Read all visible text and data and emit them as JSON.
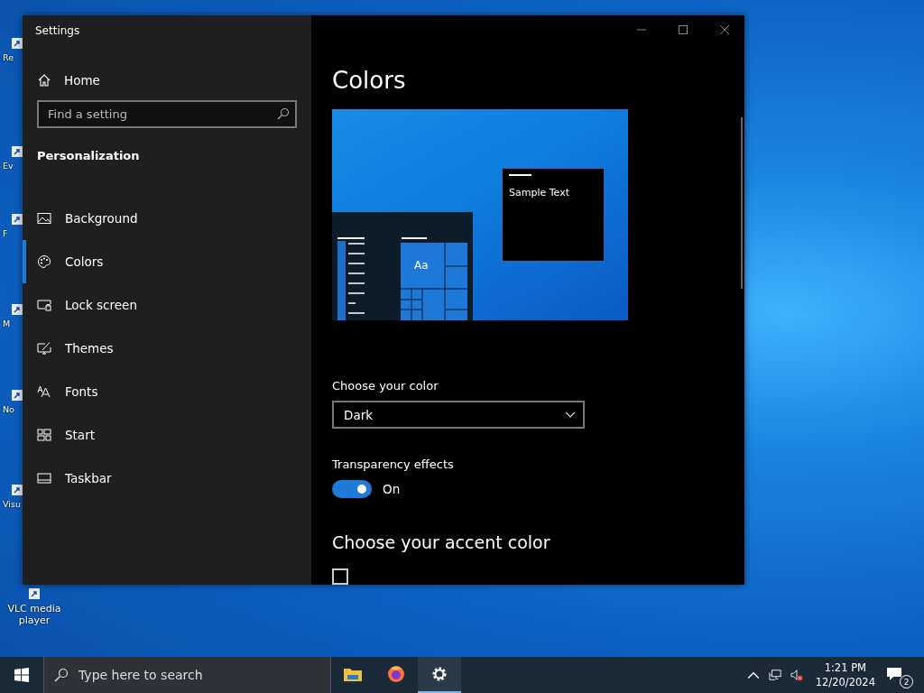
{
  "desktop": {
    "icons": [
      {
        "label": "Re"
      },
      {
        "label": "Ev"
      },
      {
        "label": "F"
      },
      {
        "label": "M"
      },
      {
        "label": "No"
      },
      {
        "label": "Visu"
      },
      {
        "label": "VLC media player"
      }
    ]
  },
  "window": {
    "title": "Settings"
  },
  "sidebar": {
    "home": "Home",
    "search": {
      "placeholder": "Find a setting"
    },
    "section": "Personalization",
    "items": [
      {
        "label": "Background",
        "selected": false
      },
      {
        "label": "Colors",
        "selected": true
      },
      {
        "label": "Lock screen",
        "selected": false
      },
      {
        "label": "Themes",
        "selected": false
      },
      {
        "label": "Fonts",
        "selected": false
      },
      {
        "label": "Start",
        "selected": false
      },
      {
        "label": "Taskbar",
        "selected": false
      }
    ]
  },
  "content": {
    "title": "Colors",
    "preview": {
      "sample_text": "Sample Text",
      "tile_text": "Aa"
    },
    "color_label": "Choose your color",
    "color_value": "Dark",
    "transparency_label": "Transparency effects",
    "transparency": {
      "on": true,
      "text": "On"
    },
    "accent_heading": "Choose your accent color",
    "auto_pick": {
      "checked": false
    }
  },
  "taskbar": {
    "search": {
      "placeholder": "Type here to search"
    },
    "apps": [
      {
        "kind": "folder",
        "selected": false
      },
      {
        "kind": "browser",
        "selected": false
      },
      {
        "kind": "settings",
        "selected": true
      }
    ],
    "time": "1:21 PM",
    "date": "12/20/2024",
    "notifications": "2"
  }
}
